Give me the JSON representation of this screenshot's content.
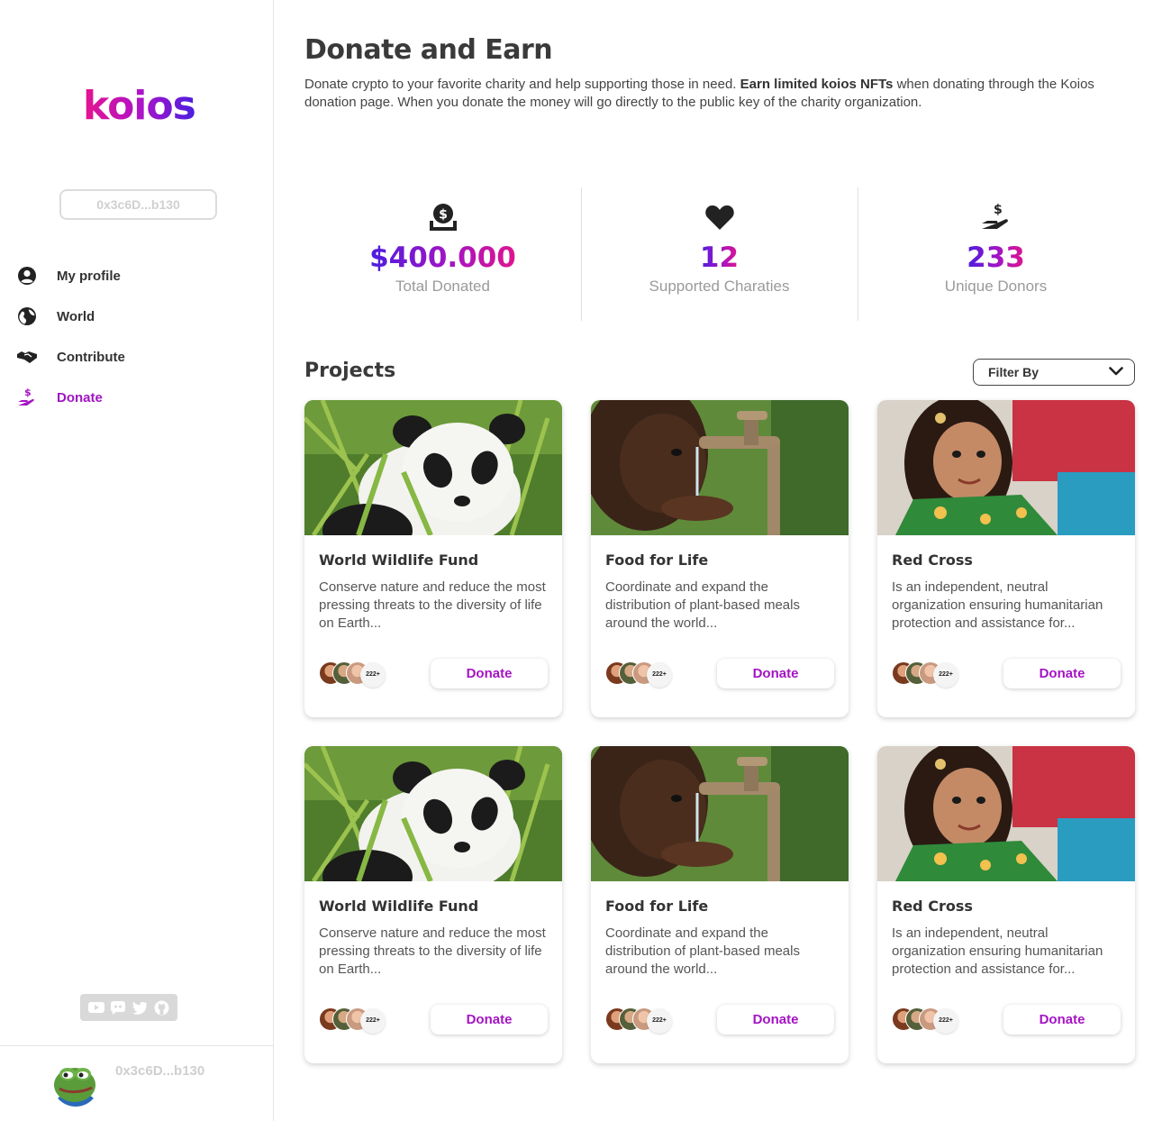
{
  "sidebar": {
    "logo": "koios",
    "wallet": "0x3c6D...b130",
    "nav": [
      {
        "label": "My profile",
        "icon": "user-circle-icon",
        "active": false
      },
      {
        "label": "World",
        "icon": "globe-icon",
        "active": false
      },
      {
        "label": "Contribute",
        "icon": "handshake-icon",
        "active": false
      },
      {
        "label": "Donate",
        "icon": "hand-dollar-icon",
        "active": true
      }
    ],
    "socials": [
      "youtube-icon",
      "discord-icon",
      "twitter-icon",
      "github-icon"
    ],
    "footer_address": "0x3c6D...b130"
  },
  "header": {
    "title": "Donate and Earn",
    "intro_1": "Donate crypto to your favorite charity and help supporting those in need. ",
    "intro_bold": "Earn limited koios NFTs",
    "intro_2": " when donating through the Koios donation page. When you donate the money will go directly to the public key of the charity organization."
  },
  "stats": [
    {
      "icon": "money-bag-icon",
      "value": "$400.000",
      "label": "Total Donated"
    },
    {
      "icon": "heart-icon",
      "value": "12",
      "label": "Supported Charaties"
    },
    {
      "icon": "hand-dollar-icon",
      "value": "233",
      "label": "Unique Donors"
    }
  ],
  "projects": {
    "title": "Projects",
    "filter_label": "Filter By",
    "cards": [
      {
        "title": "World Wildlife Fund",
        "description": "Conserve nature and reduce the most pressing threats to the diversity of life on Earth...",
        "donor_count": "222+",
        "button": "Donate",
        "image": "panda"
      },
      {
        "title": "Food for Life",
        "description": "Coordinate and expand the distribution of plant-based meals around the world...",
        "donor_count": "222+",
        "button": "Donate",
        "image": "water"
      },
      {
        "title": "Red Cross",
        "description": "Is an independent, neutral organization ensuring humanitarian protection and assistance for...",
        "donor_count": "222+",
        "button": "Donate",
        "image": "girl"
      },
      {
        "title": "World Wildlife Fund",
        "description": "Conserve nature and reduce the most pressing threats to the diversity of life on Earth...",
        "donor_count": "222+",
        "button": "Donate",
        "image": "panda"
      },
      {
        "title": "Food for Life",
        "description": "Coordinate and expand the distribution of plant-based meals around the world...",
        "donor_count": "222+",
        "button": "Donate",
        "image": "water"
      },
      {
        "title": "Red Cross",
        "description": "Is an independent, neutral organization ensuring humanitarian protection and assistance for...",
        "donor_count": "222+",
        "button": "Donate",
        "image": "girl"
      }
    ]
  },
  "colors": {
    "accent": "#a514c4",
    "gradient_start": "#4a1ee0",
    "gradient_end": "#e0148f"
  }
}
